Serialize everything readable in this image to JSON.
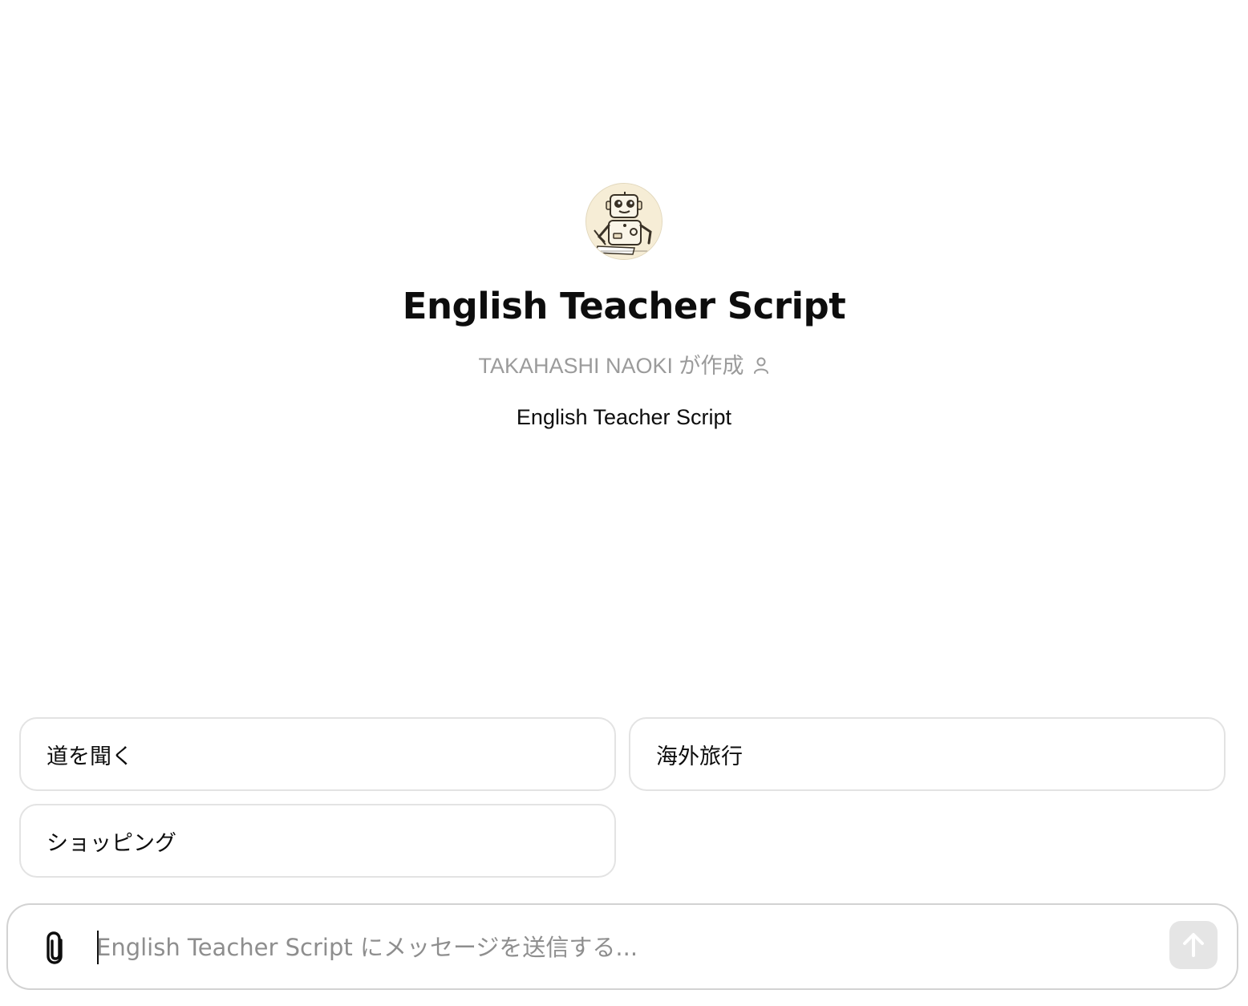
{
  "gpt": {
    "avatar_icon": "robot-writing-avatar",
    "title": "English Teacher Script",
    "creator_text": "TAKAHASHI NAOKI が作成",
    "creator_icon": "person-icon",
    "description": "English Teacher Script"
  },
  "starters": [
    {
      "label": "道を聞く"
    },
    {
      "label": "海外旅行"
    },
    {
      "label": "ショッピング"
    }
  ],
  "composer": {
    "placeholder": "English Teacher Script にメッセージを送信する...",
    "value": "",
    "attach_icon": "paperclip-icon",
    "send_icon": "arrow-up-icon"
  },
  "colors": {
    "text": "#0d0d0d",
    "muted": "#9b9b9b",
    "border": "#e3e3e3",
    "send_disabled_bg": "#e5e5e5"
  }
}
